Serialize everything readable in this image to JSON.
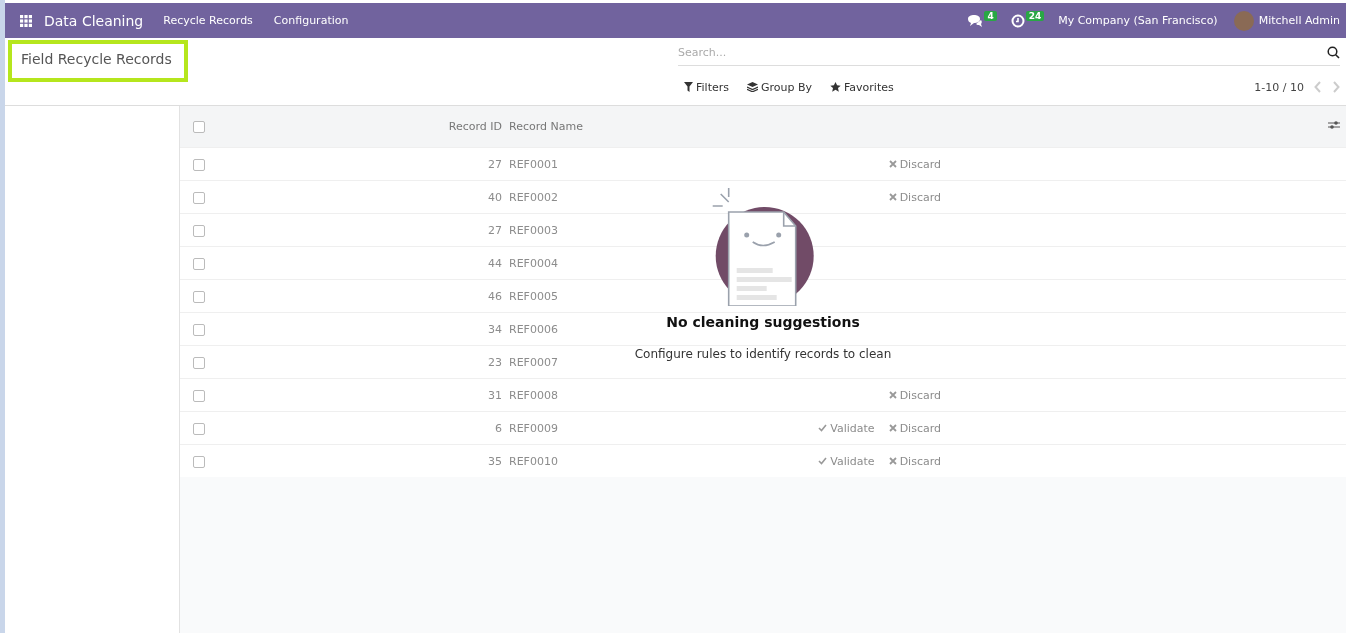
{
  "navbar": {
    "app_name": "Data Cleaning",
    "menu": [
      "Recycle Records",
      "Configuration"
    ],
    "messages_count": "4",
    "activities_count": "24",
    "company": "My Company (San Francisco)",
    "user": "Mitchell Admin"
  },
  "breadcrumb": {
    "title": "Field Recycle Records",
    "highlighted": true
  },
  "search": {
    "placeholder": "Search..."
  },
  "filters": [
    "Filters",
    "Group By",
    "Favorites"
  ],
  "pager": "1-10 / 10",
  "table": {
    "select_all_checked": false,
    "columns": [
      "Record ID",
      "Record Name"
    ],
    "rows": [
      {
        "id": "27",
        "name": "REF0001",
        "discard": "Discard",
        "checked": false
      },
      {
        "id": "40",
        "name": "REF0002",
        "discard": "Discard",
        "checked": false
      },
      {
        "id": "27",
        "name": "REF0003",
        "checked": false
      },
      {
        "id": "44",
        "name": "REF0004",
        "checked": false
      },
      {
        "id": "46",
        "name": "REF0005",
        "checked": false
      },
      {
        "id": "34",
        "name": "REF0006",
        "checked": false
      },
      {
        "id": "23",
        "name": "REF0007",
        "checked": false
      },
      {
        "id": "31",
        "name": "REF0008",
        "discard": "Discard",
        "checked": false
      },
      {
        "id": "6",
        "name": "REF0009",
        "validate": "Validate",
        "discard": "Discard",
        "checked": false
      },
      {
        "id": "35",
        "name": "REF0010",
        "validate": "Validate",
        "discard": "Discard",
        "checked": false
      }
    ]
  },
  "empty_state": {
    "title": "No cleaning suggestions",
    "message": "Configure rules to identify records to clean"
  }
}
